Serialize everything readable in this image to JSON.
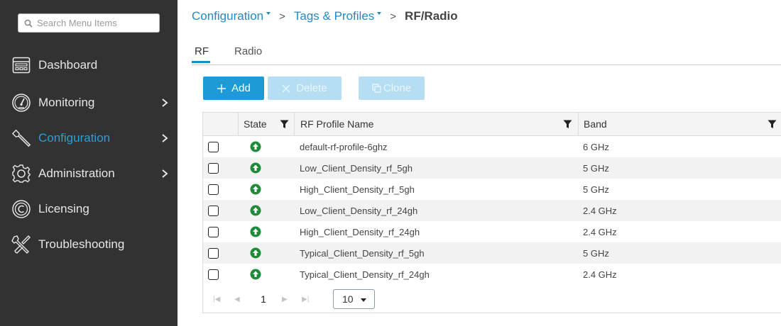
{
  "sidebar": {
    "search": {
      "placeholder": "Search Menu Items"
    },
    "items": [
      {
        "label": "Dashboard",
        "icon": "dashboard-icon",
        "has_submenu": false,
        "active": false
      },
      {
        "label": "Monitoring",
        "icon": "gauge-icon",
        "has_submenu": true,
        "active": false
      },
      {
        "label": "Configuration",
        "icon": "wrench-icon",
        "has_submenu": true,
        "active": true
      },
      {
        "label": "Administration",
        "icon": "gear-icon",
        "has_submenu": true,
        "active": false
      },
      {
        "label": "Licensing",
        "icon": "licensing-icon",
        "has_submenu": false,
        "active": false
      },
      {
        "label": "Troubleshooting",
        "icon": "tools-icon",
        "has_submenu": false,
        "active": false
      }
    ]
  },
  "breadcrumb": {
    "items": [
      "Configuration",
      "Tags & Profiles"
    ],
    "separator": ">",
    "current": "RF/Radio"
  },
  "tabs": [
    {
      "label": "RF",
      "active": true
    },
    {
      "label": "Radio",
      "active": false
    }
  ],
  "toolbar": {
    "add_label": "Add",
    "delete_label": "Delete",
    "clone_label": "Clone"
  },
  "table": {
    "columns": [
      "State",
      "RF Profile Name",
      "Band"
    ],
    "rows": [
      {
        "state": "up",
        "name": "default-rf-profile-6ghz",
        "band": "6 GHz"
      },
      {
        "state": "up",
        "name": "Low_Client_Density_rf_5gh",
        "band": "5 GHz"
      },
      {
        "state": "up",
        "name": "High_Client_Density_rf_5gh",
        "band": "5 GHz"
      },
      {
        "state": "up",
        "name": "Low_Client_Density_rf_24gh",
        "band": "2.4 GHz"
      },
      {
        "state": "up",
        "name": "High_Client_Density_rf_24gh",
        "band": "2.4 GHz"
      },
      {
        "state": "up",
        "name": "Typical_Client_Density_rf_5gh",
        "band": "5 GHz"
      },
      {
        "state": "up",
        "name": "Typical_Client_Density_rf_24gh",
        "band": "2.4 GHz"
      }
    ]
  },
  "pagination": {
    "current_page": "1",
    "page_size": "10"
  },
  "colors": {
    "sidebar_bg": "#323232",
    "accent": "#1e9bd7",
    "active_nav": "#1ea4dd",
    "state_up": "#1e8a3a"
  }
}
